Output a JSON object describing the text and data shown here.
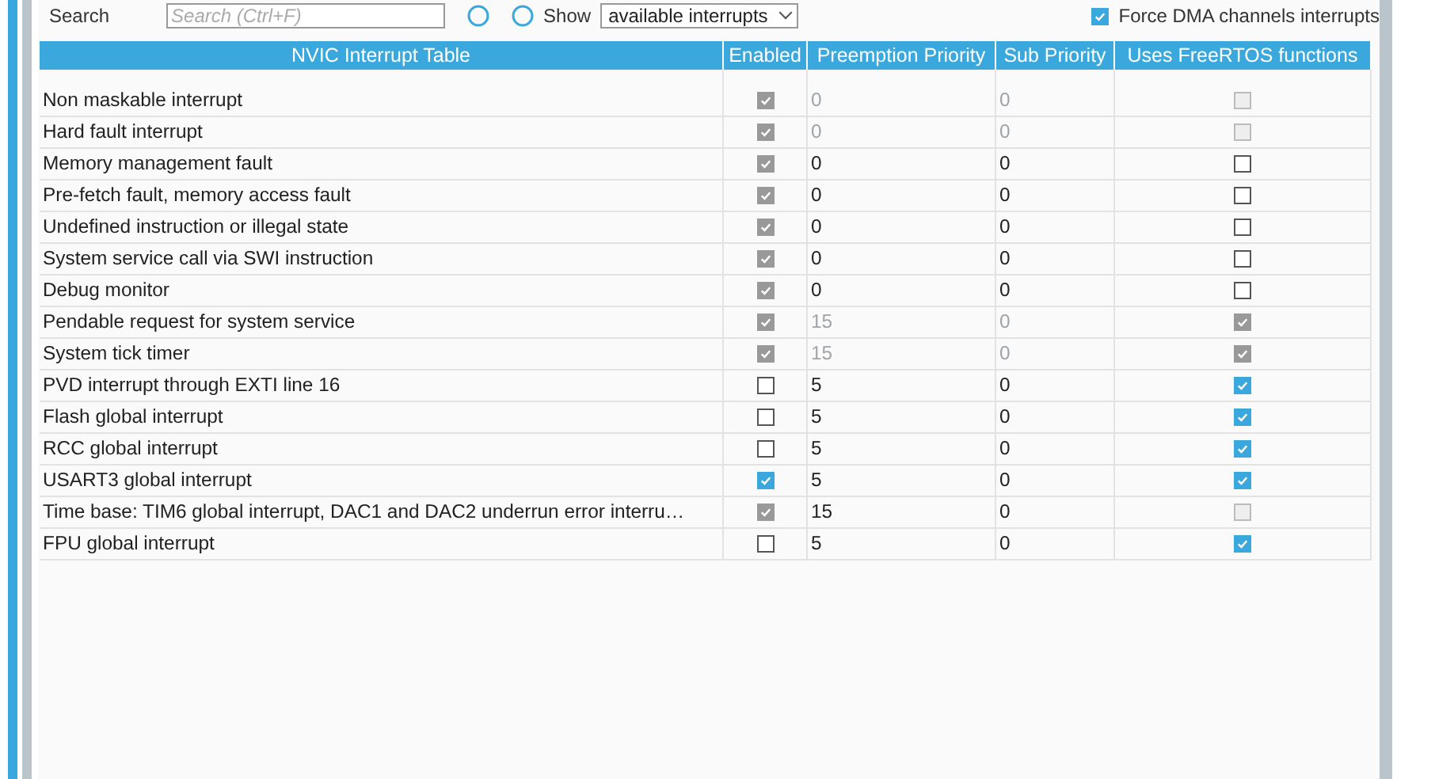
{
  "toolbar": {
    "search_label": "Search",
    "search_placeholder": "Search (Ctrl+F)",
    "show_label": "Show",
    "show_value": "available interrupts",
    "force_dma": {
      "label": "Force DMA channels interrupts",
      "checked": true
    }
  },
  "table": {
    "columns": [
      "NVIC Interrupt Table",
      "Enabled",
      "Preemption Priority",
      "Sub Priority",
      "Uses FreeRTOS functions"
    ],
    "rows": [
      {
        "name": "Non maskable interrupt",
        "enabled": {
          "checked": true,
          "disabled": true
        },
        "preemption": {
          "text": "0",
          "disabled": true
        },
        "sub": {
          "text": "0",
          "disabled": true
        },
        "freertos": {
          "checked": false,
          "disabled": true
        }
      },
      {
        "name": "Hard fault interrupt",
        "enabled": {
          "checked": true,
          "disabled": true
        },
        "preemption": {
          "text": "0",
          "disabled": true
        },
        "sub": {
          "text": "0",
          "disabled": true
        },
        "freertos": {
          "checked": false,
          "disabled": true
        }
      },
      {
        "name": "Memory management fault",
        "enabled": {
          "checked": true,
          "disabled": true
        },
        "preemption": {
          "text": "0",
          "disabled": false
        },
        "sub": {
          "text": "0",
          "disabled": false
        },
        "freertos": {
          "checked": false,
          "disabled": false
        }
      },
      {
        "name": "Pre-fetch fault, memory access fault",
        "enabled": {
          "checked": true,
          "disabled": true
        },
        "preemption": {
          "text": "0",
          "disabled": false
        },
        "sub": {
          "text": "0",
          "disabled": false
        },
        "freertos": {
          "checked": false,
          "disabled": false
        }
      },
      {
        "name": "Undefined instruction or illegal state",
        "enabled": {
          "checked": true,
          "disabled": true
        },
        "preemption": {
          "text": "0",
          "disabled": false
        },
        "sub": {
          "text": "0",
          "disabled": false
        },
        "freertos": {
          "checked": false,
          "disabled": false
        }
      },
      {
        "name": "System service call via SWI instruction",
        "enabled": {
          "checked": true,
          "disabled": true
        },
        "preemption": {
          "text": "0",
          "disabled": false
        },
        "sub": {
          "text": "0",
          "disabled": false
        },
        "freertos": {
          "checked": false,
          "disabled": false
        }
      },
      {
        "name": "Debug monitor",
        "enabled": {
          "checked": true,
          "disabled": true
        },
        "preemption": {
          "text": "0",
          "disabled": false
        },
        "sub": {
          "text": "0",
          "disabled": false
        },
        "freertos": {
          "checked": false,
          "disabled": false
        }
      },
      {
        "name": "Pendable request for system service",
        "enabled": {
          "checked": true,
          "disabled": true
        },
        "preemption": {
          "text": "15",
          "disabled": true
        },
        "sub": {
          "text": "0",
          "disabled": true
        },
        "freertos": {
          "checked": true,
          "disabled": true
        }
      },
      {
        "name": "System tick timer",
        "enabled": {
          "checked": true,
          "disabled": true
        },
        "preemption": {
          "text": "15",
          "disabled": true
        },
        "sub": {
          "text": "0",
          "disabled": true
        },
        "freertos": {
          "checked": true,
          "disabled": true
        }
      },
      {
        "name": "PVD interrupt through EXTI line 16",
        "enabled": {
          "checked": false,
          "disabled": false
        },
        "preemption": {
          "text": "5",
          "disabled": false
        },
        "sub": {
          "text": "0",
          "disabled": false
        },
        "freertos": {
          "checked": true,
          "disabled": false
        }
      },
      {
        "name": "Flash global interrupt",
        "enabled": {
          "checked": false,
          "disabled": false
        },
        "preemption": {
          "text": "5",
          "disabled": false
        },
        "sub": {
          "text": "0",
          "disabled": false
        },
        "freertos": {
          "checked": true,
          "disabled": false
        }
      },
      {
        "name": "RCC global interrupt",
        "enabled": {
          "checked": false,
          "disabled": false
        },
        "preemption": {
          "text": "5",
          "disabled": false
        },
        "sub": {
          "text": "0",
          "disabled": false
        },
        "freertos": {
          "checked": true,
          "disabled": false
        }
      },
      {
        "name": "USART3 global interrupt",
        "enabled": {
          "checked": true,
          "disabled": false
        },
        "preemption": {
          "text": "5",
          "disabled": false
        },
        "sub": {
          "text": "0",
          "disabled": false
        },
        "freertos": {
          "checked": true,
          "disabled": false
        }
      },
      {
        "name": "Time base: TIM6 global interrupt, DAC1 and DAC2 underrun error interru…",
        "enabled": {
          "checked": true,
          "disabled": true
        },
        "preemption": {
          "text": "15",
          "disabled": false
        },
        "sub": {
          "text": "0",
          "disabled": false
        },
        "freertos": {
          "checked": false,
          "disabled": true
        }
      },
      {
        "name": "FPU global interrupt",
        "enabled": {
          "checked": false,
          "disabled": false
        },
        "preemption": {
          "text": "5",
          "disabled": false
        },
        "sub": {
          "text": "0",
          "disabled": false
        },
        "freertos": {
          "checked": true,
          "disabled": false
        }
      }
    ]
  }
}
